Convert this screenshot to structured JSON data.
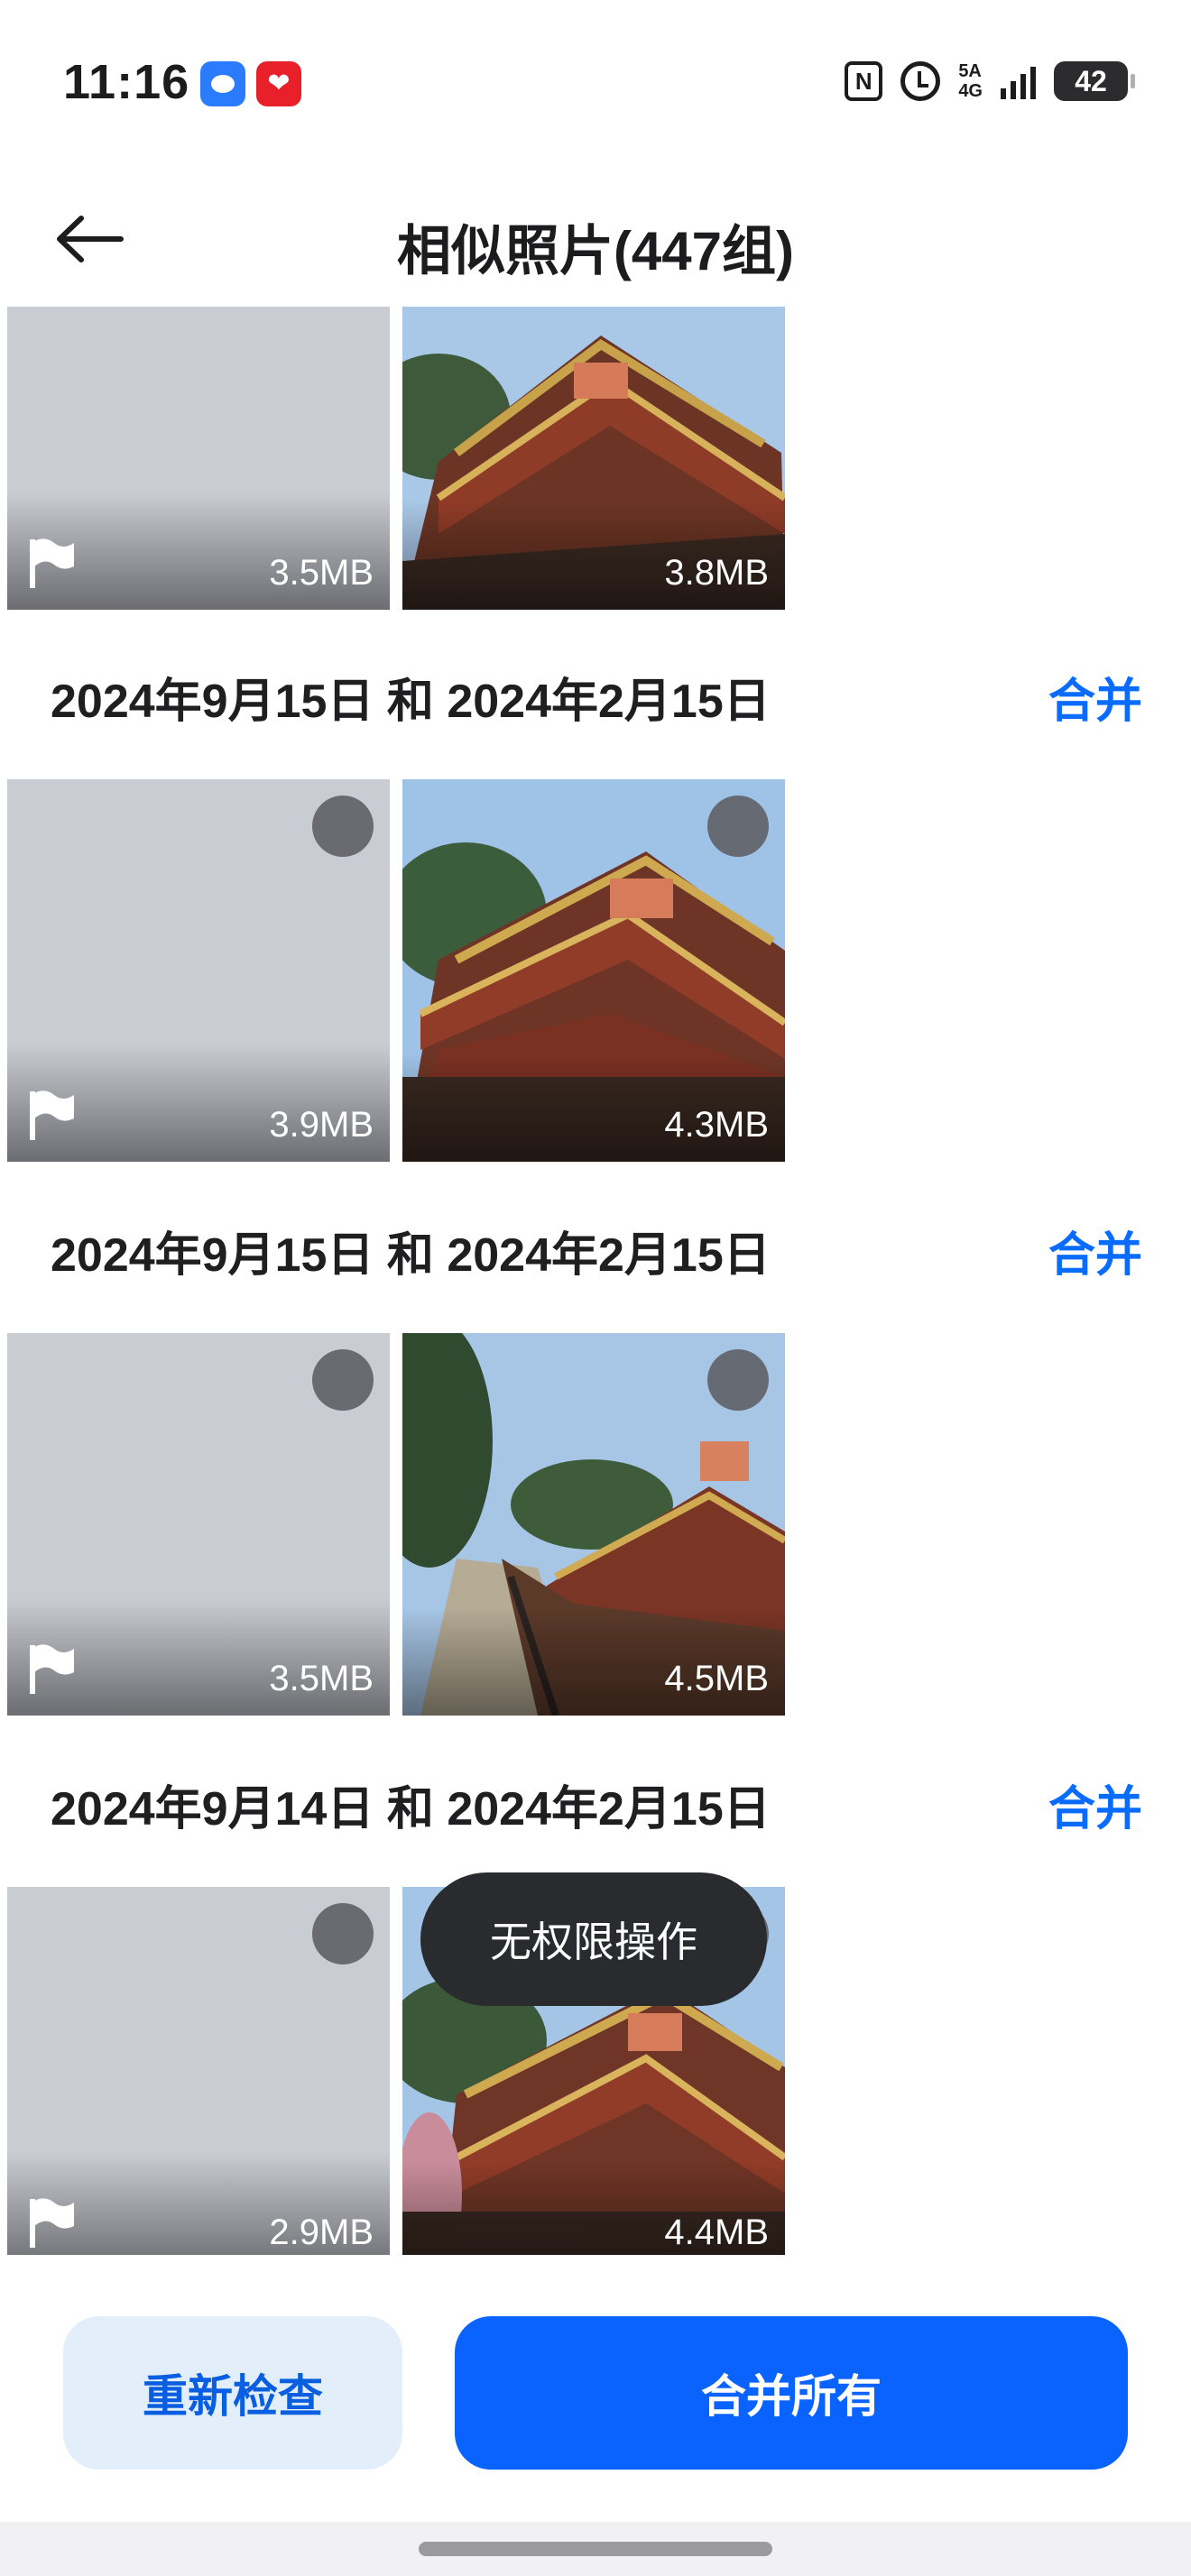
{
  "status_bar": {
    "time": "11:16",
    "notif_icons": [
      "message-icon",
      "heart-app-icon"
    ],
    "nfc": "N",
    "network_top": "5A",
    "network_bottom": "4G",
    "battery": "42"
  },
  "header": {
    "title": "相似照片(447组)",
    "back_icon": "arrow-left-icon"
  },
  "groups": [
    {
      "date": "",
      "merge_label": "",
      "photos": [
        {
          "kind": "placeholder",
          "size": "3.5MB",
          "flag": true,
          "selectable": false
        },
        {
          "kind": "temple",
          "size": "3.8MB",
          "flag": false,
          "selectable": false
        }
      ]
    },
    {
      "date": "2024年9月15日 和 2024年2月15日",
      "merge_label": "合并",
      "photos": [
        {
          "kind": "placeholder",
          "size": "3.9MB",
          "flag": true,
          "selectable": true
        },
        {
          "kind": "temple",
          "size": "4.3MB",
          "flag": false,
          "selectable": true
        }
      ]
    },
    {
      "date": "2024年9月15日 和 2024年2月15日",
      "merge_label": "合并",
      "photos": [
        {
          "kind": "placeholder",
          "size": "3.5MB",
          "flag": true,
          "selectable": true
        },
        {
          "kind": "temple",
          "size": "4.5MB",
          "flag": false,
          "selectable": true
        }
      ]
    },
    {
      "date": "2024年9月14日 和 2024年2月15日",
      "merge_label": "合并",
      "photos": [
        {
          "kind": "placeholder",
          "size": "2.9MB",
          "flag": true,
          "selectable": true
        },
        {
          "kind": "temple",
          "size": "4.4MB",
          "flag": false,
          "selectable": true
        }
      ]
    }
  ],
  "toast": "无权限操作",
  "actions": {
    "recheck_label": "重新检查",
    "merge_all_label": "合并所有"
  },
  "colors": {
    "accent": "#0a63ff",
    "link": "#0a6cff",
    "secondary_button_bg": "#e3eefb",
    "toast_bg": "#2a2b2e"
  }
}
